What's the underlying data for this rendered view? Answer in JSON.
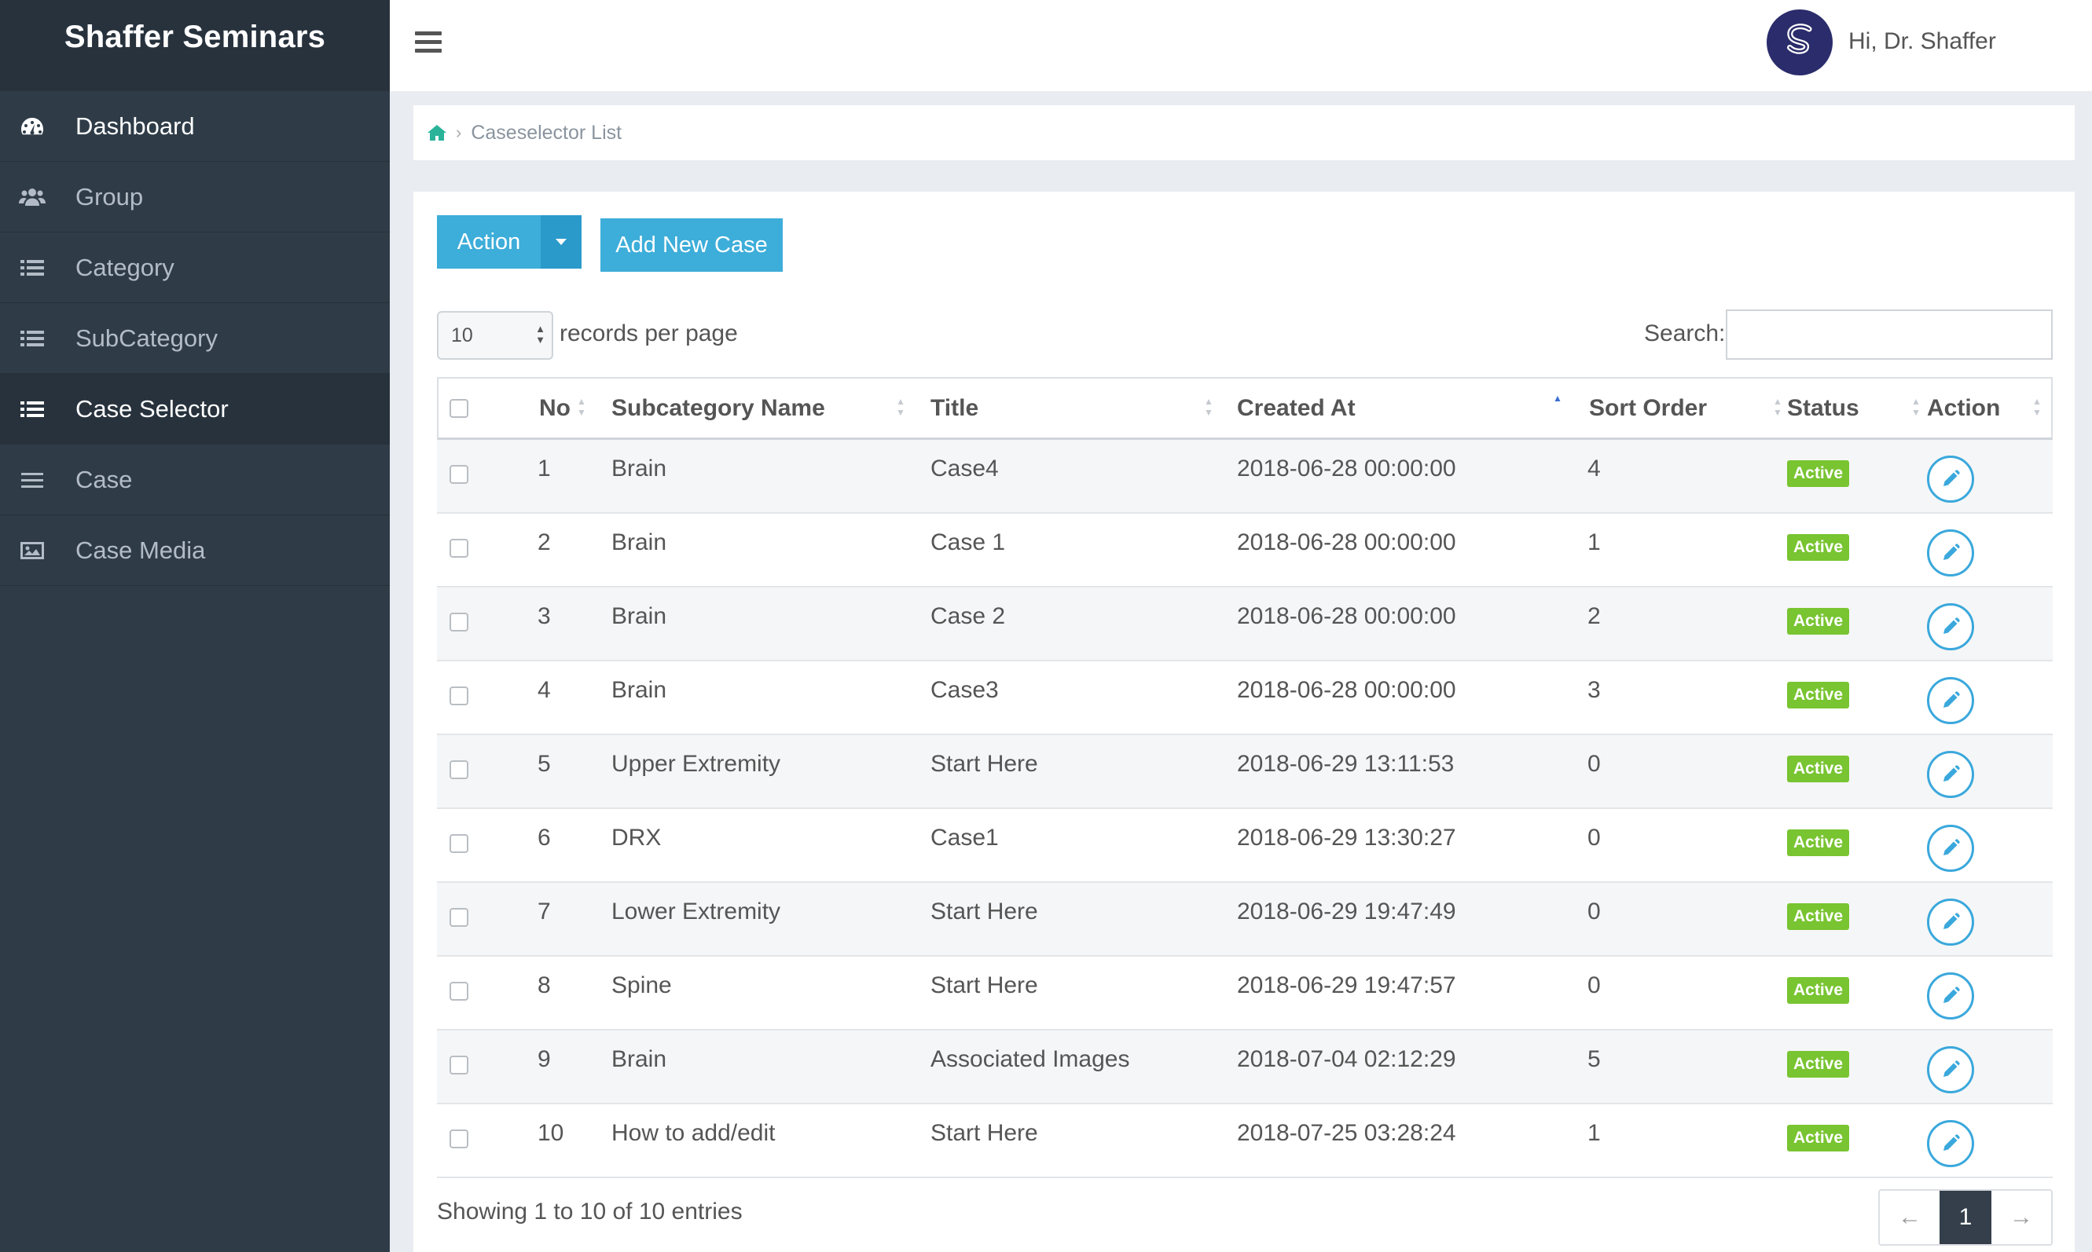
{
  "app": {
    "brand": "Shaffer Seminars",
    "user_greeting": "Hi, Dr. Shaffer",
    "colors": {
      "sidebar": "#2f3c48",
      "accent": "#3dadd9",
      "status_active": "#78c431"
    }
  },
  "sidebar": {
    "items": [
      {
        "label": "Dashboard",
        "icon": "dashboard-icon"
      },
      {
        "label": "Group",
        "icon": "users-icon"
      },
      {
        "label": "Category",
        "icon": "list-icon"
      },
      {
        "label": "SubCategory",
        "icon": "list-icon"
      },
      {
        "label": "Case Selector",
        "icon": "list-icon",
        "active": true
      },
      {
        "label": "Case",
        "icon": "bars-icon"
      },
      {
        "label": "Case Media",
        "icon": "image-icon"
      }
    ]
  },
  "breadcrumb": {
    "home_icon": "home-icon",
    "current": "Caseselector List"
  },
  "toolbar": {
    "action_label": "Action",
    "add_label": "Add New Case"
  },
  "table_controls": {
    "per_page_value": "10",
    "per_page_label": "records per page",
    "search_label": "Search:",
    "search_value": ""
  },
  "table": {
    "columns": [
      "No",
      "Subcategory Name",
      "Title",
      "Created At",
      "Sort Order",
      "Status",
      "Action"
    ],
    "rows": [
      {
        "no": "1",
        "subcategory": "Brain",
        "title": "Case4",
        "created": "2018-06-28 00:00:00",
        "sort": "4",
        "status": "Active"
      },
      {
        "no": "2",
        "subcategory": "Brain",
        "title": "Case 1",
        "created": "2018-06-28 00:00:00",
        "sort": "1",
        "status": "Active"
      },
      {
        "no": "3",
        "subcategory": "Brain",
        "title": "Case 2",
        "created": "2018-06-28 00:00:00",
        "sort": "2",
        "status": "Active"
      },
      {
        "no": "4",
        "subcategory": "Brain",
        "title": "Case3",
        "created": "2018-06-28 00:00:00",
        "sort": "3",
        "status": "Active"
      },
      {
        "no": "5",
        "subcategory": "Upper Extremity",
        "title": "Start Here",
        "created": "2018-06-29 13:11:53",
        "sort": "0",
        "status": "Active"
      },
      {
        "no": "6",
        "subcategory": "DRX",
        "title": "Case1",
        "created": "2018-06-29 13:30:27",
        "sort": "0",
        "status": "Active"
      },
      {
        "no": "7",
        "subcategory": "Lower Extremity",
        "title": "Start Here",
        "created": "2018-06-29 19:47:49",
        "sort": "0",
        "status": "Active"
      },
      {
        "no": "8",
        "subcategory": "Spine",
        "title": "Start Here",
        "created": "2018-06-29 19:47:57",
        "sort": "0",
        "status": "Active"
      },
      {
        "no": "9",
        "subcategory": "Brain",
        "title": "Associated Images",
        "created": "2018-07-04 02:12:29",
        "sort": "5",
        "status": "Active"
      },
      {
        "no": "10",
        "subcategory": "How to add/edit",
        "title": "Start Here",
        "created": "2018-07-25 03:28:24",
        "sort": "1",
        "status": "Active"
      }
    ]
  },
  "footer": {
    "info": "Showing 1 to 10 of 10 entries",
    "prev": "←",
    "page": "1",
    "next": "→"
  }
}
